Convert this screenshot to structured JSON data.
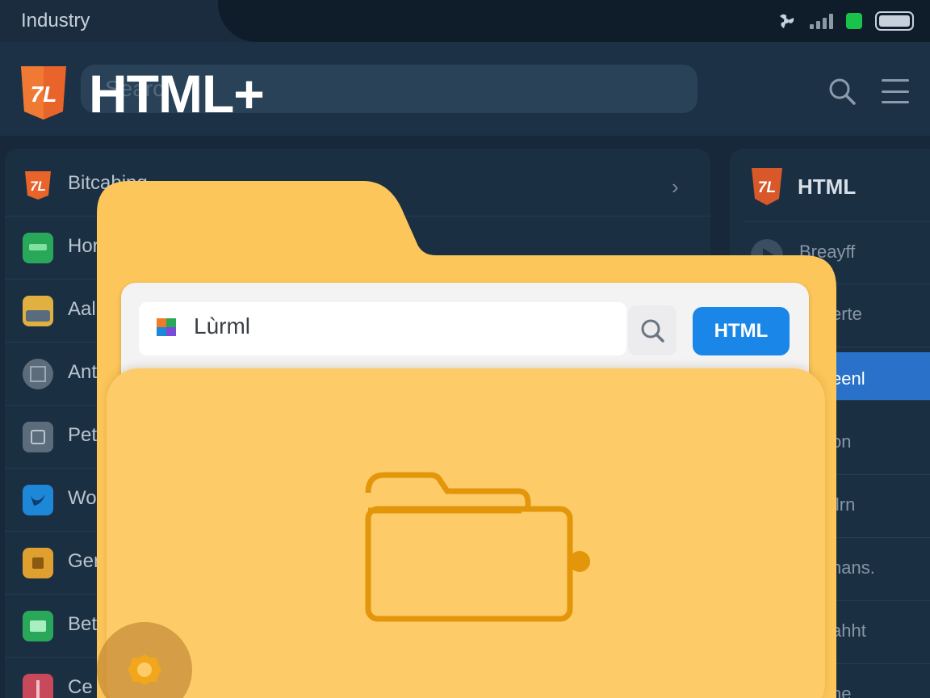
{
  "status_bar": {
    "title": "Industry"
  },
  "header": {
    "title": "HTML+",
    "search_placeholder": "Search"
  },
  "left_list": {
    "items": [
      {
        "label": "Bitcabing",
        "icon": "html-logo-icon",
        "color": "#e8732a"
      },
      {
        "label": "Hor",
        "icon": "sheet-icon",
        "color": "#2aa85a"
      },
      {
        "label": "Aal",
        "icon": "wallet-icon",
        "color": "#e0b040"
      },
      {
        "label": "Ant",
        "icon": "grid-icon",
        "color": "#6b7b8b"
      },
      {
        "label": "Pet",
        "icon": "square-icon",
        "color": "#6b7b8b"
      },
      {
        "label": "Wor",
        "icon": "bird-icon",
        "color": "#1e88d8"
      },
      {
        "label": "Ger",
        "icon": "box-icon",
        "color": "#e0a030"
      },
      {
        "label": "Bet",
        "icon": "image-icon",
        "color": "#2aa85a"
      },
      {
        "label": "Ce",
        "icon": "cross-icon",
        "color": "#c84a5a"
      }
    ]
  },
  "right_list": {
    "title": "HTML",
    "items": [
      {
        "label": "Breayff"
      },
      {
        "label": "erte"
      },
      {
        "label": "eenl"
      },
      {
        "label": "on"
      },
      {
        "label": "ilrn"
      },
      {
        "label": "hans."
      },
      {
        "label": "ahht"
      },
      {
        "label": "ne"
      }
    ],
    "active_index": 2
  },
  "browser": {
    "url_text": "Lùrml",
    "button_label": "HTML"
  },
  "colors": {
    "accent": "#1a86e8",
    "folder": "#fdcb68",
    "brand": "#e8642a"
  }
}
